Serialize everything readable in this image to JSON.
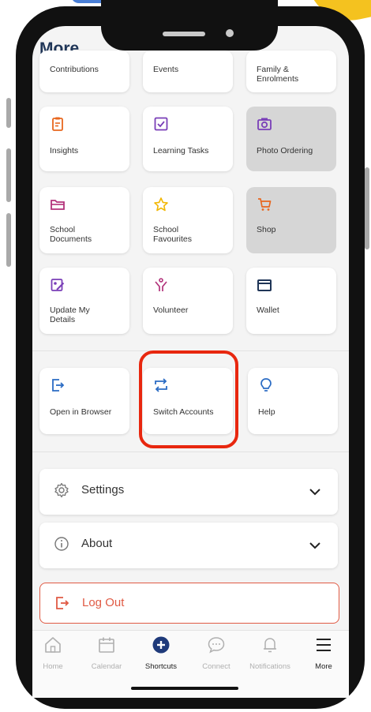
{
  "header": {
    "title": "More"
  },
  "top_row_partial": [
    "Contributions",
    "Events",
    "Family & Enrolments"
  ],
  "grid_row1": [
    "Insights",
    "Learning Tasks",
    "Photo Ordering"
  ],
  "grid_row2": [
    "School Documents",
    "School Favourites",
    "Shop"
  ],
  "grid_row3": [
    "Update My Details",
    "Volunteer",
    "Wallet"
  ],
  "actions": [
    "Open in Browser",
    "Switch Accounts",
    "Help"
  ],
  "settings": {
    "label": "Settings"
  },
  "about": {
    "label": "About"
  },
  "logout": {
    "label": "Log Out"
  },
  "tabbar": {
    "items": [
      "Home",
      "Calendar",
      "Shortcuts",
      "Connect",
      "Notifications",
      "More"
    ],
    "active": "Shortcuts"
  },
  "colors": {
    "title": "#1f3557",
    "orange": "#e8671f",
    "purple": "#7a3fb8",
    "magenta": "#b2327a",
    "yellow": "#f2b705",
    "blue": "#2b6cc4",
    "logout_red": "#e05a44",
    "highlight_red": "#e8270f"
  }
}
